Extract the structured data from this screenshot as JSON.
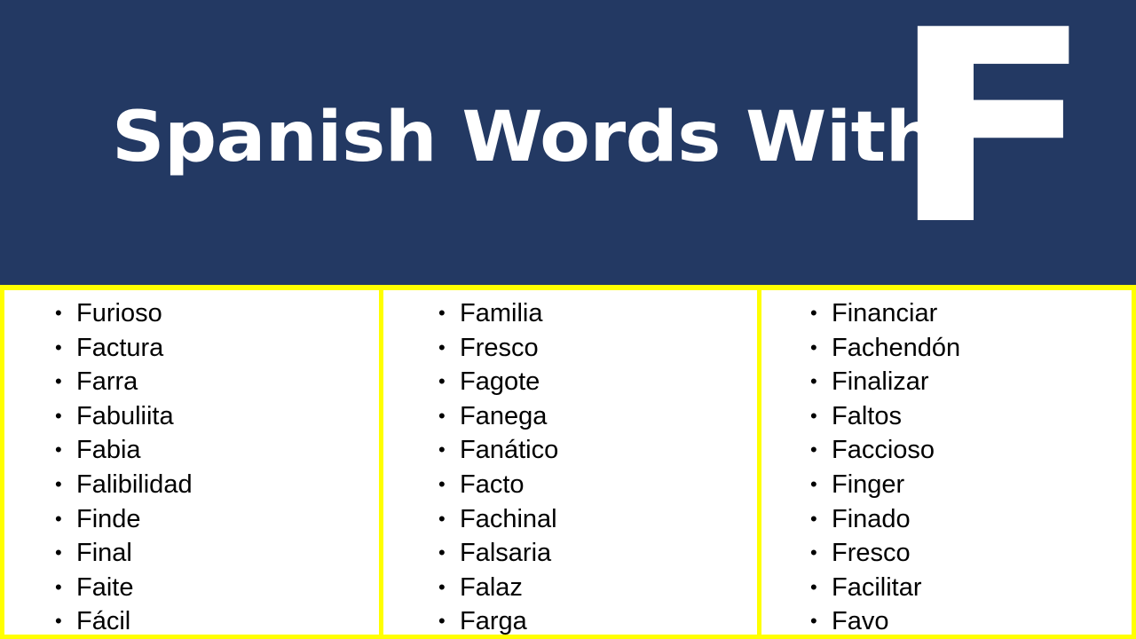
{
  "slide": {
    "title": "Spanish Words With",
    "feature_letter": "F",
    "bullet_glyph": "•",
    "colors": {
      "banner_background": "#233963",
      "banner_text": "#FFFFFF",
      "divider": "#FFFF00",
      "list_background": "#FFFFFF",
      "list_text": "#000000"
    }
  },
  "columns": [
    {
      "name": "column-1",
      "words": [
        "Furioso",
        "Factura",
        "Farra",
        "Fabuliita",
        "Fabia",
        "Falibilidad",
        "Finde",
        "Final",
        "Faite",
        "Fácil"
      ]
    },
    {
      "name": "column-2",
      "words": [
        "Familia",
        "Fresco",
        "Fagote",
        "Fanega",
        "Fanático",
        "Facto",
        "Fachinal",
        "Falsaria",
        "Falaz",
        "Farga"
      ]
    },
    {
      "name": "column-3",
      "words": [
        "Financiar",
        "Fachendón",
        "Finalizar",
        "Faltos",
        "Faccioso",
        "Finger",
        "Finado",
        "Fresco",
        "Facilitar",
        "Favo"
      ]
    }
  ]
}
